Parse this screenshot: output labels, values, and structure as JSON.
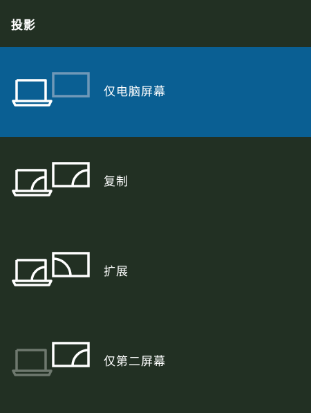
{
  "panel": {
    "title": "投影"
  },
  "options": [
    {
      "label": "仅电脑屏幕",
      "selected": true,
      "icon": "pc-screen-only-icon"
    },
    {
      "label": "复制",
      "selected": false,
      "icon": "duplicate-icon"
    },
    {
      "label": "扩展",
      "selected": false,
      "icon": "extend-icon"
    },
    {
      "label": "仅第二屏幕",
      "selected": false,
      "icon": "second-screen-only-icon"
    }
  ],
  "colors": {
    "background": "#223023",
    "selected": "#0a5f93",
    "icon_active": "#ffffff",
    "icon_dim_on_blue": "#6f98b8",
    "icon_dim": "#6e786e"
  }
}
